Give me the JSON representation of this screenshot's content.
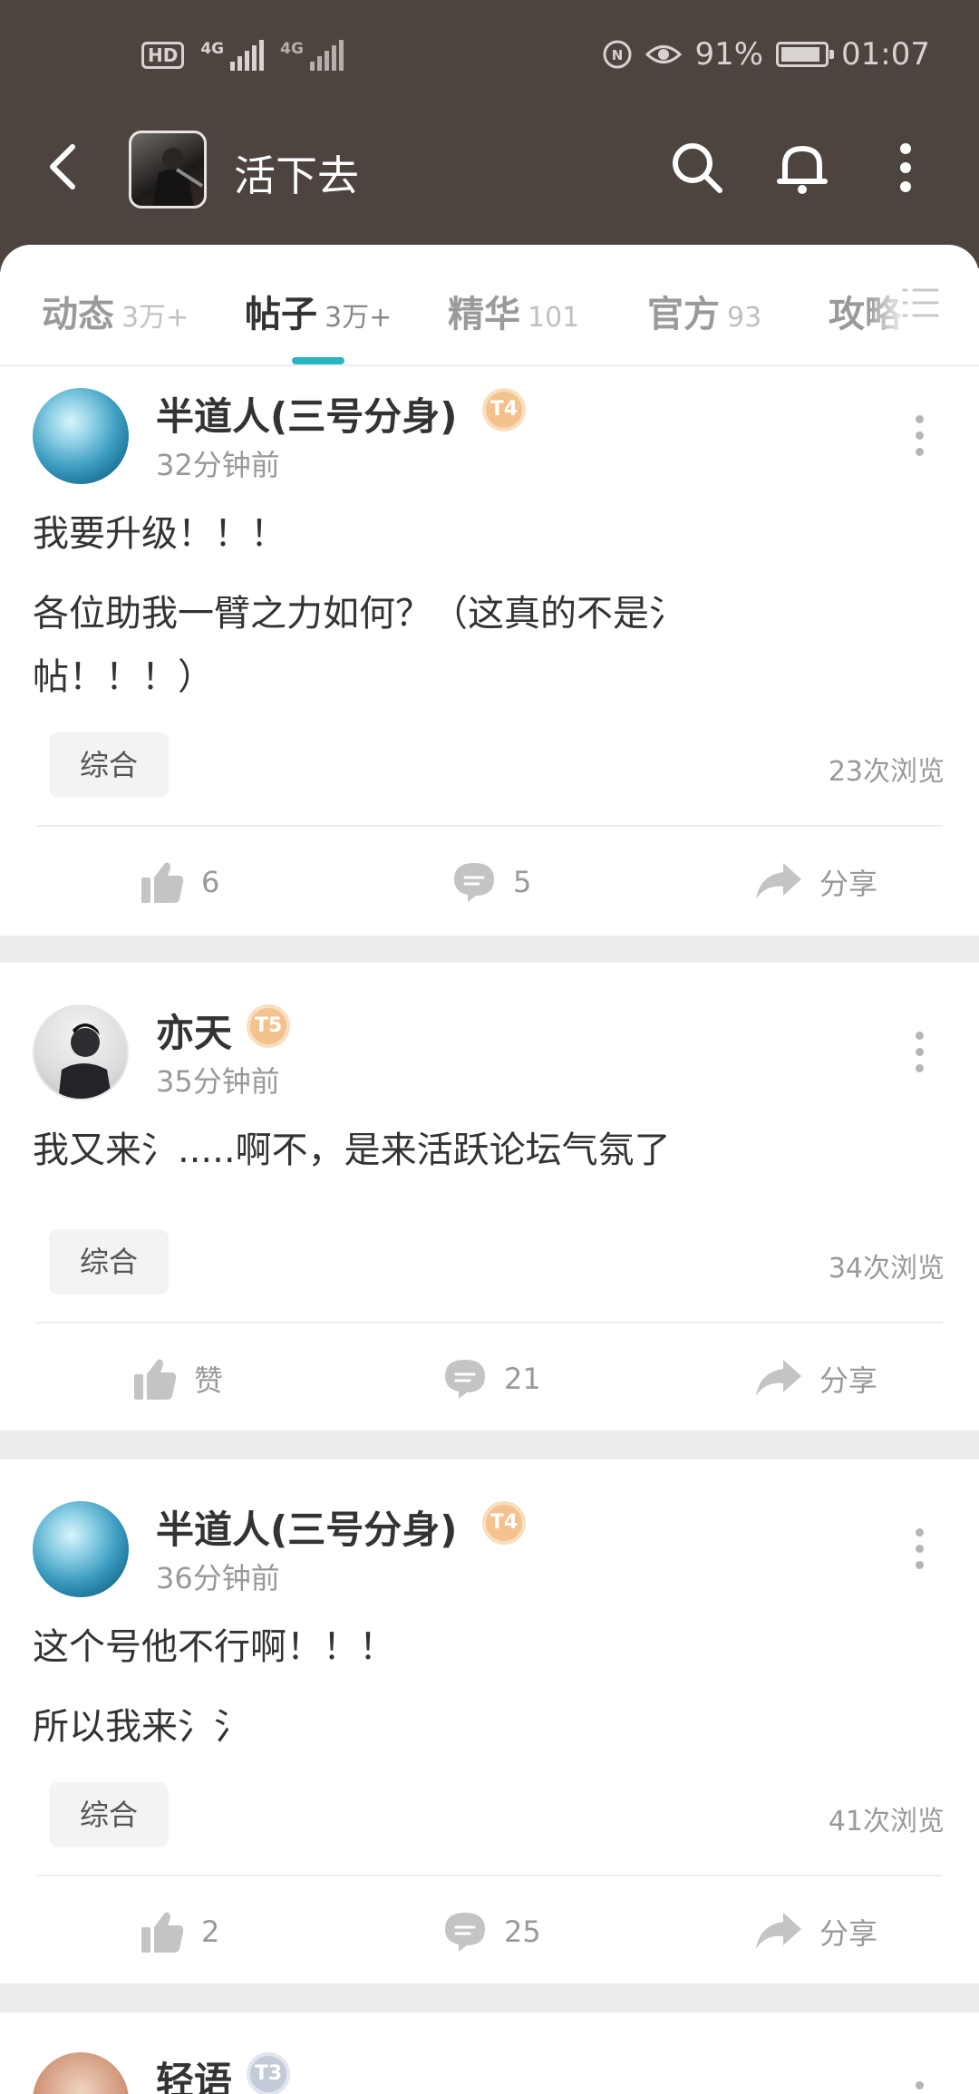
{
  "status_bar": {
    "hd_label": "HD",
    "sim1": "4G",
    "sim2": "4G",
    "battery_percent": "91%",
    "battery_level": 0.91,
    "time": "01:07"
  },
  "topbar": {
    "title": "活下去",
    "icons": [
      "back-arrow-icon",
      "search-icon",
      "bell-icon",
      "more-vertical-icon"
    ]
  },
  "tabs": [
    {
      "label": "动态",
      "count": "3万+",
      "active": false
    },
    {
      "label": "帖子",
      "count": "3万+",
      "active": true
    },
    {
      "label": "精华",
      "count": "101",
      "active": false
    },
    {
      "label": "官方",
      "count": "93",
      "active": false
    },
    {
      "label": "攻略",
      "count": "",
      "active": false
    }
  ],
  "posts": [
    {
      "username": "半道人(三号分身)",
      "level": "T4",
      "time": "32分钟前",
      "lines": [
        "我要升级！！！",
        "各位助我一臂之力如何？（这真的不是氵",
        "帖！！！）"
      ],
      "tag": "综合",
      "views": "23次浏览",
      "likes": "6",
      "comments": "5",
      "share": "分享"
    },
    {
      "username": "亦天",
      "level": "T5",
      "time": "35分钟前",
      "lines": [
        "我又来氵.....啊不，是来活跃论坛气氛了"
      ],
      "tag": "综合",
      "views": "34次浏览",
      "likes": "赞",
      "comments": "21",
      "share": "分享"
    },
    {
      "username": "半道人(三号分身)",
      "level": "T4",
      "time": "36分钟前",
      "lines": [
        "这个号他不行啊！！！",
        "所以我来氵氵"
      ],
      "tag": "综合",
      "views": "41次浏览",
      "likes": "2",
      "comments": "25",
      "share": "分享"
    },
    {
      "username": "轻语",
      "level": "T3"
    }
  ],
  "colors": {
    "header_bg": "#4d4440",
    "accent": "#28b6c0",
    "level_badge": "#f3c28d"
  }
}
